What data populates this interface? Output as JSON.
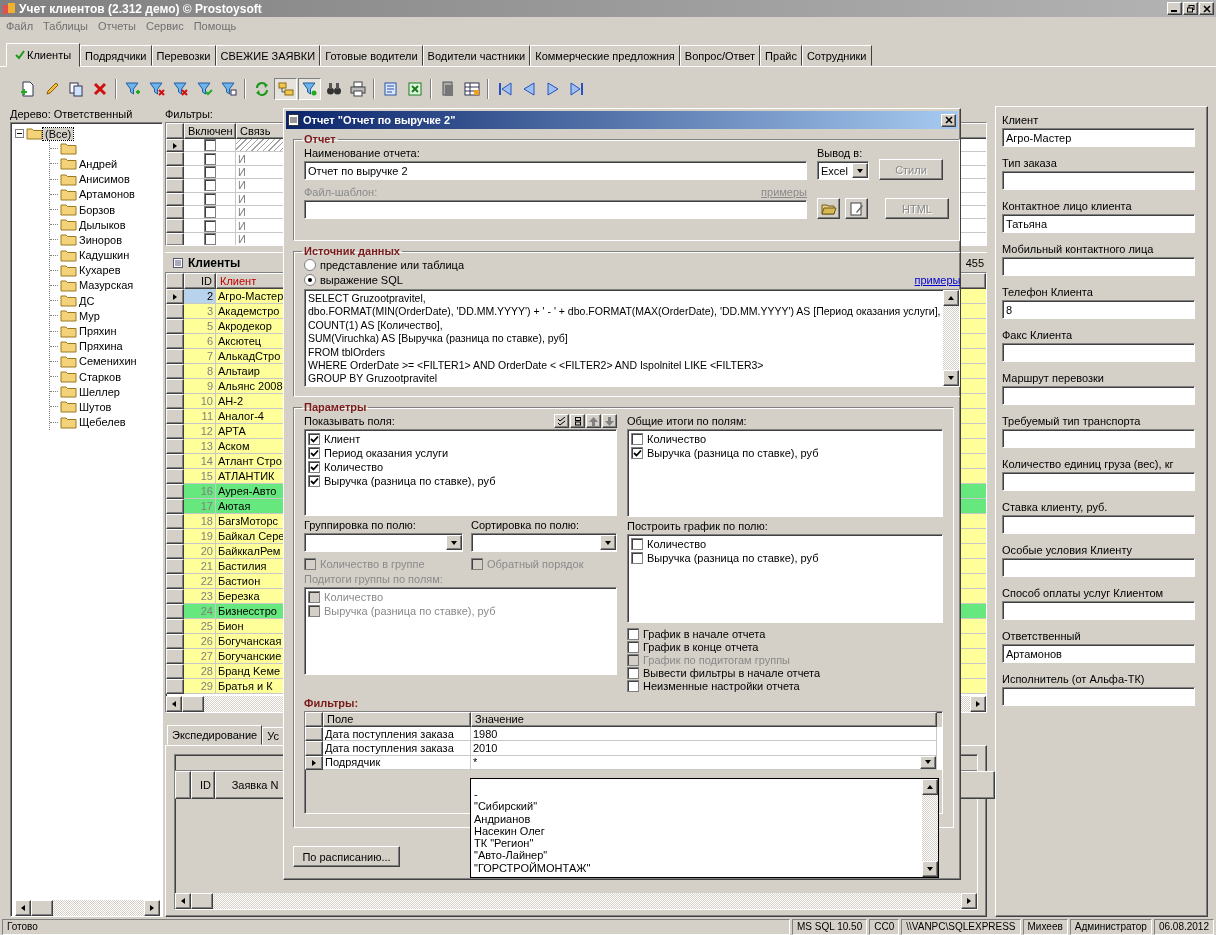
{
  "window": {
    "title": "Учет клиентов (2.312 демо) © Prostoysoft"
  },
  "menu": [
    "Файл",
    "Таблицы",
    "Отчеты",
    "Сервис",
    "Помощь"
  ],
  "tabs": [
    {
      "label": "Клиенты",
      "selected": true
    },
    {
      "label": "Подрядчики",
      "selected": false
    },
    {
      "label": "Перевозки",
      "selected": false
    },
    {
      "label": "СВЕЖИЕ ЗАЯВКИ",
      "selected": false
    },
    {
      "label": "Готовые водители",
      "selected": false
    },
    {
      "label": "Водители частники",
      "selected": false
    },
    {
      "label": "Коммерческие предложния",
      "selected": false
    },
    {
      "label": "Вопрос/Ответ",
      "selected": false
    },
    {
      "label": "Прайс",
      "selected": false
    },
    {
      "label": "Сотрудники",
      "selected": false
    }
  ],
  "toolbar": [
    {
      "kind": "new",
      "pressed": false
    },
    {
      "kind": "edit",
      "pressed": false
    },
    {
      "kind": "copy",
      "pressed": false
    },
    {
      "kind": "delete",
      "pressed": false
    },
    {
      "kind": "separator"
    },
    {
      "kind": "filter_add",
      "pressed": false
    },
    {
      "kind": "filter_remove",
      "pressed": false
    },
    {
      "kind": "filter_clear",
      "pressed": false
    },
    {
      "kind": "filter_check",
      "pressed": false
    },
    {
      "kind": "filter_edit",
      "pressed": false
    },
    {
      "kind": "separator"
    },
    {
      "kind": "refresh",
      "pressed": false
    },
    {
      "kind": "tree",
      "pressed": true
    },
    {
      "kind": "filter_view",
      "pressed": true
    },
    {
      "kind": "find",
      "pressed": false
    },
    {
      "kind": "print",
      "pressed": false
    },
    {
      "kind": "separator"
    },
    {
      "kind": "word",
      "pressed": false
    },
    {
      "kind": "excel",
      "pressed": false
    },
    {
      "kind": "separator"
    },
    {
      "kind": "report",
      "pressed": false
    },
    {
      "kind": "table",
      "pressed": false
    },
    {
      "kind": "separator"
    },
    {
      "kind": "first",
      "pressed": false
    },
    {
      "kind": "prev",
      "pressed": false
    },
    {
      "kind": "next",
      "pressed": false
    },
    {
      "kind": "last",
      "pressed": false
    }
  ],
  "tree": {
    "label": "Дерево: Ответственный",
    "root": {
      "label": "(Все)",
      "expanded": true,
      "selected": true,
      "children": [
        {
          "kind": "folder"
        },
        {
          "kind": "folder",
          "label": "Андрей"
        },
        {
          "kind": "folder",
          "label": "Анисимов"
        },
        {
          "kind": "folder",
          "label": "Артамонов"
        },
        {
          "kind": "folder",
          "label": "Борзов"
        },
        {
          "kind": "folder",
          "label": "Дылыков"
        },
        {
          "kind": "folder",
          "label": "Зиноров"
        },
        {
          "kind": "folder",
          "label": "Кадушкин"
        },
        {
          "kind": "folder",
          "label": "Кухарев"
        },
        {
          "kind": "folder",
          "label": "Мазурская"
        },
        {
          "kind": "folder",
          "label": "ДС"
        },
        {
          "kind": "folder",
          "label": "Мур"
        },
        {
          "kind": "folder",
          "label": "Пряхин"
        },
        {
          "kind": "folder",
          "label": "Пряхина"
        },
        {
          "kind": "folder",
          "label": "Семенихин"
        },
        {
          "kind": "folder",
          "label": "Старков"
        },
        {
          "kind": "folder",
          "label": "Шеллер"
        },
        {
          "kind": "folder",
          "label": "Шутов"
        },
        {
          "kind": "folder",
          "label": "Щебелев"
        }
      ]
    }
  },
  "filters": {
    "label": "Фильтры:",
    "columns": [
      "Включен",
      "Связь"
    ],
    "rows": [
      {
        "enabled": false,
        "selected": true
      },
      {
        "enabled": false,
        "link": "И",
        "selected": false
      },
      {
        "enabled": false,
        "link": "И",
        "selected": false
      },
      {
        "enabled": false,
        "link": "И",
        "selected": false
      },
      {
        "enabled": false,
        "link": "И",
        "selected": false
      },
      {
        "enabled": false,
        "link": "И",
        "selected": false
      },
      {
        "enabled": false,
        "link": "И",
        "selected": false
      },
      {
        "enabled": false,
        "link": "И",
        "selected": false
      }
    ]
  },
  "clients": {
    "title": "Клиенты",
    "count": "455",
    "columns": [
      "ID",
      "Клиент"
    ],
    "rows": [
      {
        "id": "2",
        "name": "Агро-Мастер",
        "color": "#ffff99",
        "selected": true
      },
      {
        "id": "3",
        "name": "Академстро",
        "color": "#ffff99",
        "selected": false
      },
      {
        "id": "5",
        "name": "Акродекор",
        "color": "#ffff99",
        "selected": false
      },
      {
        "id": "6",
        "name": "Аксютец",
        "color": "#ffff99",
        "selected": false
      },
      {
        "id": "7",
        "name": "АлькадСтро",
        "color": "#ffff99",
        "selected": false
      },
      {
        "id": "8",
        "name": "Альтаир",
        "color": "#ffff99",
        "selected": false
      },
      {
        "id": "9",
        "name": "Альянс 2008",
        "color": "#ffff99",
        "selected": false
      },
      {
        "id": "10",
        "name": "АН-2",
        "color": "#ffff99",
        "selected": false
      },
      {
        "id": "11",
        "name": "Аналог-4",
        "color": "#ffff99",
        "selected": false
      },
      {
        "id": "12",
        "name": "АРТА",
        "color": "#ffff99",
        "selected": false
      },
      {
        "id": "13",
        "name": "Аском",
        "color": "#ffff99",
        "selected": false
      },
      {
        "id": "14",
        "name": "Атлант Стро",
        "color": "#ffff99",
        "selected": false
      },
      {
        "id": "15",
        "name": "АТЛАНТИК",
        "color": "#ffff99",
        "selected": false
      },
      {
        "id": "16",
        "name": "Аурея-Авто",
        "color": "#66e87e",
        "selected": false
      },
      {
        "id": "17",
        "name": "Аютая",
        "color": "#66e87e",
        "selected": false
      },
      {
        "id": "18",
        "name": "БагзМоторс",
        "color": "#ffff99",
        "selected": false
      },
      {
        "id": "19",
        "name": "Байкал Сере",
        "color": "#ffff99",
        "selected": false
      },
      {
        "id": "20",
        "name": "БайккалРем",
        "color": "#ffff99",
        "selected": false
      },
      {
        "id": "21",
        "name": "Бастилия",
        "color": "#ffff99",
        "selected": false
      },
      {
        "id": "22",
        "name": "Бастион",
        "color": "#ffff99",
        "selected": false
      },
      {
        "id": "23",
        "name": "Березка",
        "color": "#ffff99",
        "selected": false
      },
      {
        "id": "24",
        "name": "Бизнесстро",
        "color": "#66e87e",
        "selected": false
      },
      {
        "id": "25",
        "name": "Бион",
        "color": "#ffff99",
        "selected": false
      },
      {
        "id": "26",
        "name": "Богучанская",
        "color": "#ffff99",
        "selected": false
      },
      {
        "id": "27",
        "name": "Богучанские",
        "color": "#ffff99",
        "selected": false
      },
      {
        "id": "28",
        "name": "Бранд Keме",
        "color": "#ffff99",
        "selected": false
      },
      {
        "id": "29",
        "name": "Братья и К",
        "color": "#ffff99",
        "selected": false
      }
    ]
  },
  "detail_tabs": [
    {
      "label": "Экспедирование",
      "selected": true
    },
    {
      "label": "Ус",
      "selected": false
    }
  ],
  "detail_grid": {
    "columns": [
      "ID",
      "Заявка N"
    ]
  },
  "client_card": [
    {
      "label": "Клиент",
      "value": "Агро-Мастер"
    },
    {
      "label": "Тип заказа"
    },
    {
      "label": "Контактное лицо клиента",
      "value": "Татьяна"
    },
    {
      "label": "Мобильный контактного лица"
    },
    {
      "label": "Телефон Клиента",
      "value": "8"
    },
    {
      "label": "Факс Клиента"
    },
    {
      "label": "Маршрут перевозки"
    },
    {
      "label": "Требуемый тип транспорта"
    },
    {
      "label": "Количество единиц груза (вес), кг"
    },
    {
      "label": "Ставка клиенту, руб."
    },
    {
      "label": "Особые условия Клиенту"
    },
    {
      "label": "Способ оплаты услуг Клиентом"
    },
    {
      "label": "Ответственный",
      "value": "Артамонов"
    },
    {
      "label": "Исполнитель (от Альфа-ТК)"
    }
  ],
  "status_bar": [
    "Готово",
    "MS SQL 10.50",
    "CC0",
    "\\\\VANPC\\SQLEXPRESS",
    "Михеев",
    "Администратор",
    "06.08.2012"
  ],
  "report_dialog": {
    "title": "Отчет \"Отчет по выручке 2\"",
    "report_group": {
      "title": "Отчет",
      "name_label": "Наименование отчета:",
      "name_value": "Отчет по выручке 2",
      "output_label": "Вывод в:",
      "output_value": "Excel",
      "styles_button": {
        "label": "Стили",
        "disabled": true
      },
      "template_label": {
        "label": "Файл-шаблон:",
        "disabled": true
      },
      "examples_link": {
        "label": "примеры",
        "disabled": true
      },
      "html_button": {
        "label": "HTML",
        "disabled": true
      }
    },
    "source_group": {
      "title": "Источник данных",
      "options": [
        {
          "label": "представление или таблица",
          "selected": false
        },
        {
          "label": "выражение SQL",
          "selected": true
        }
      ],
      "examples_link": {
        "label": "примеры",
        "disabled": false
      },
      "sql_lines": [
        "SELECT Gruzootpravitel,",
        "dbo.FORMAT(MIN(OrderDate), 'DD.MM.YYYY') + ' - ' + dbo.FORMAT(MAX(OrderDate), 'DD.MM.YYYY') AS [Период оказания услуги],",
        "COUNT(1) AS [Количество],",
        "SUM(Viruchka) AS [Выручка (разница по ставке), руб]",
        "FROM tblOrders",
        "WHERE OrderDate >= <FILTER1> AND OrderDate < <FILTER2> AND Ispolnitel LIKE <FILTER3>",
        "GROUP BY Gruzootpravitel"
      ]
    },
    "params_group": {
      "title": "Параметры",
      "show_fields": {
        "label": "Показывать поля:",
        "items": [
          {
            "label": "Клиент",
            "checked": true
          },
          {
            "label": "Период оказания услуги",
            "checked": true
          },
          {
            "label": "Количество",
            "checked": true
          },
          {
            "label": "Выручка (разница по ставке), руб",
            "checked": true
          }
        ]
      },
      "totals": {
        "label": "Общие итоги по полям:",
        "items": [
          {
            "label": "Количество",
            "checked": false
          },
          {
            "label": "Выручка (разница по ставке), руб",
            "checked": true
          }
        ]
      },
      "grouping": {
        "label": "Группировка по полю:"
      },
      "sorting": {
        "label": "Сортировка по полю:"
      },
      "count_in_group": {
        "label": "Количество в группе",
        "checked": false,
        "disabled": true
      },
      "reverse_order": {
        "label": "Обратный порядок",
        "checked": false,
        "disabled": true
      },
      "subtotals": {
        "label": "Подитоги группы по полям:",
        "disabled": true,
        "items": [
          {
            "label": "Количество",
            "checked": false
          },
          {
            "label": "Выручка (разница по ставке), руб",
            "checked": false
          }
        ]
      },
      "chart": {
        "label": "Построить график по полю:",
        "items": [
          {
            "label": "Количество",
            "checked": false
          },
          {
            "label": "Выручка (разница по ставке), руб",
            "checked": false
          }
        ]
      },
      "options": [
        {
          "label": "График в начале отчета",
          "checked": false,
          "disabled": false
        },
        {
          "label": "График в конце отчета",
          "checked": false,
          "disabled": false
        },
        {
          "label": "График по подитогам группы",
          "checked": false,
          "disabled": true
        },
        {
          "label": "Вывести фильтры в начале отчета",
          "checked": false,
          "disabled": false
        },
        {
          "label": "Неизменные настройки отчета",
          "checked": false,
          "disabled": false
        }
      ]
    },
    "filters": {
      "title": "Фильтры:",
      "columns": [
        "Поле",
        "Значение"
      ],
      "rows": [
        {
          "field": "Дата поступления заказа",
          "value": "1980",
          "selected": false
        },
        {
          "field": "Дата поступления заказа",
          "value": "2010",
          "selected": false
        },
        {
          "field": "Подрядчик",
          "value": "*",
          "selected": true
        }
      ],
      "dropdown": [
        "-",
        "\"Сибирский\"",
        "Андрианов",
        "Насекин Олег",
        "ТК \"Регион\"",
        "\"Авто-Лайнер\"",
        "\"ГОРСТРОЙМОНТАЖ\""
      ]
    },
    "schedule_button": "По расписанию..."
  }
}
